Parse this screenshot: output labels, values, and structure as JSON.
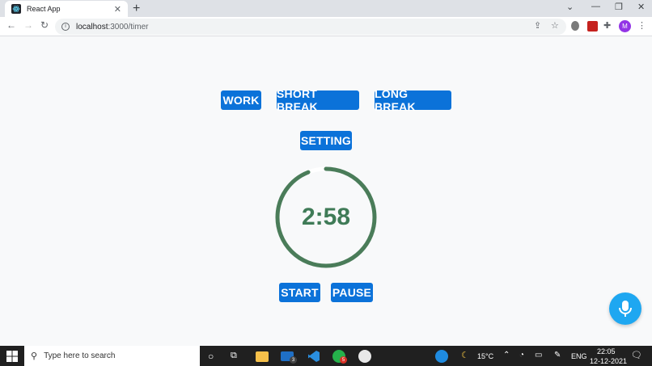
{
  "browser": {
    "tab_title": "React App",
    "tab_close": "✕",
    "new_tab": "+",
    "url_host": "localhost",
    "url_path": ":3000/timer",
    "profile_initial": "M"
  },
  "nav": {
    "work": "WORK",
    "short_break": "SHORT BREAK",
    "long_break": "LONG BREAK",
    "setting": "SETTING"
  },
  "timer": {
    "display": "2:58",
    "remaining_fraction": 0.94,
    "ring_color": "#4a7c59",
    "track_color": "#ffffff"
  },
  "controls": {
    "start": "START",
    "pause": "PAUSE"
  },
  "taskbar": {
    "search_placeholder": "Type here to search",
    "temperature": "15°C",
    "language": "ENG",
    "time": "22:05",
    "date": "12-12-2021",
    "mail_badge": "3",
    "whatsapp_badge": "5"
  },
  "colors": {
    "accent": "#0b72d9",
    "mic": "#1ea7f1"
  }
}
